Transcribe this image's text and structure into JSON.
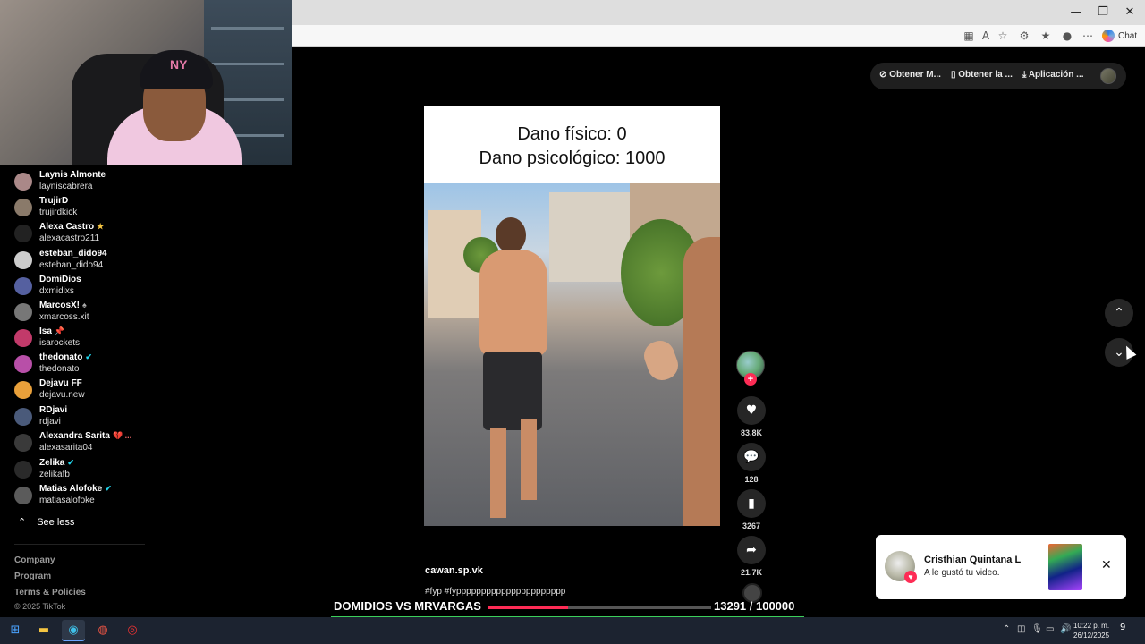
{
  "browser": {
    "window_controls": [
      "—",
      "❐",
      "✕"
    ],
    "chat_label": "Chat"
  },
  "top_pill": {
    "item1": "Obtener M...",
    "item2": "Obtener la ...",
    "item3": "Aplicación ..."
  },
  "sidebar": {
    "following": [
      {
        "name": "Laynis Almonte",
        "handle": "layniscabrera",
        "badge": ""
      },
      {
        "name": "TrujirD",
        "handle": "trujirdkick",
        "badge": ""
      },
      {
        "name": "Alexa Castro",
        "handle": "alexacastro211",
        "badge": "★"
      },
      {
        "name": "esteban_dido94",
        "handle": "esteban_dido94",
        "badge": ""
      },
      {
        "name": "DomiDios",
        "handle": "dxmidixs",
        "badge": ""
      },
      {
        "name": "MarcosX!",
        "handle": "xmarcoss.xit",
        "badge": "♠"
      },
      {
        "name": "Isa",
        "handle": "isarockets",
        "badge": "📌"
      },
      {
        "name": "thedonato",
        "handle": "thedonato",
        "badge": "✔"
      },
      {
        "name": "Dejavu FF",
        "handle": "dejavu.new",
        "badge": ""
      },
      {
        "name": "RDjavi",
        "handle": "rdjavi",
        "badge": ""
      },
      {
        "name": "Alexandra Sarita",
        "handle": "alexasarita04",
        "badge": "💔 ..."
      },
      {
        "name": "Zelika",
        "handle": "zelikafb",
        "badge": "✔"
      },
      {
        "name": "Matias  Alofoke",
        "handle": "matiasalofoke",
        "badge": "✔"
      }
    ],
    "see_less": "See less",
    "footer": {
      "company": "Company",
      "program": "Program",
      "terms": "Terms & Policies",
      "copyright": "© 2025 TikTok"
    }
  },
  "video": {
    "caption_line1": "Dano físico: 0",
    "caption_line2": "Dano psicológico: 1000",
    "author": "cawan.sp.vk",
    "description": "#fyp #fypppppppppppppppppppppp"
  },
  "actions": {
    "plus": "+",
    "likes": "83.8K",
    "comments": "128",
    "saves": "3267",
    "shares": "21.7K"
  },
  "stream_overlay": {
    "title": "DOMIDIOS VS MRVARGAS",
    "count": "13291   / 100000",
    "progress": 0.1329
  },
  "notification": {
    "name": "Cristhian Quintana L",
    "text": "A le gustó tu video."
  },
  "taskbar": {
    "time": "10:22 p. m.",
    "date": "26/12/2025",
    "notif_count": "9"
  },
  "colors": {
    "accent_red": "#fe2c55",
    "goal_green": "#3ccf5a"
  }
}
